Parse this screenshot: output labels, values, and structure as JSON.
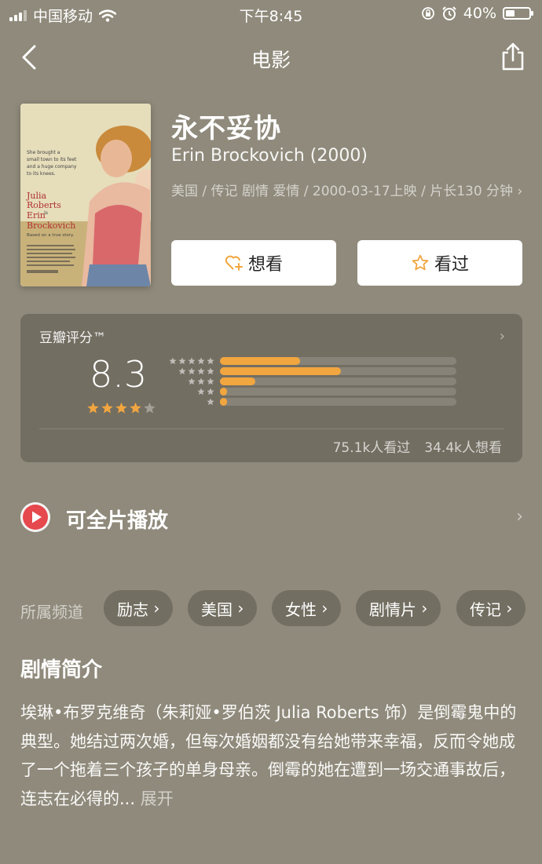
{
  "status_bar": {
    "carrier": "中国移动",
    "time": "下午8:45",
    "battery_percent": "40%",
    "battery_level": 0.4,
    "icons": [
      "signal-icon",
      "wifi-icon",
      "rotation-lock-icon",
      "alarm-icon",
      "battery-icon"
    ]
  },
  "nav": {
    "title": "电影",
    "back_icon": "chevron-left-icon",
    "share_icon": "share-icon"
  },
  "movie": {
    "title": "永不妥协",
    "original_title": "Erin Brockovich (2000)",
    "meta": "美国 / 传记 剧情 爱情 / 2000-03-17上映 / 片长130 分钟",
    "meta_chevron": "›",
    "poster": {
      "tagline": "She brought a small town to its feet and a huge company to its knees.",
      "star": "Julia Roberts",
      "title_line1": "Erin",
      "title_is": "is",
      "title_line2": "Brockovich",
      "based": "Based on a true story."
    }
  },
  "actions": {
    "want_label": "想看",
    "seen_label": "看过"
  },
  "rating": {
    "label": "豆瓣评分™",
    "score": "8.3",
    "stars": 4,
    "distribution": [
      0.34,
      0.51,
      0.15,
      0.03,
      0.03
    ],
    "seen_count": "75.1k人看过",
    "want_count": "34.4k人想看",
    "accent_color": "#f2a63f"
  },
  "play": {
    "label": "可全片播放",
    "icon": "play-icon",
    "icon_color": "#e5484d"
  },
  "channels": {
    "label": "所属频道",
    "items": [
      "励志",
      "美国",
      "女性",
      "剧情片",
      "传记"
    ]
  },
  "synopsis": {
    "title": "剧情简介",
    "text": "埃琳•布罗克维奇（朱莉娅•罗伯茨 Julia Roberts 饰）是倒霉鬼中的典型。她结过两次婚，但每次婚姻都没有给她带来幸福，反而令她成了一个拖着三个孩子的单身母亲。倒霉的她在遭到一场交通事故后，连志在必得的...",
    "expand_label": "展开"
  }
}
